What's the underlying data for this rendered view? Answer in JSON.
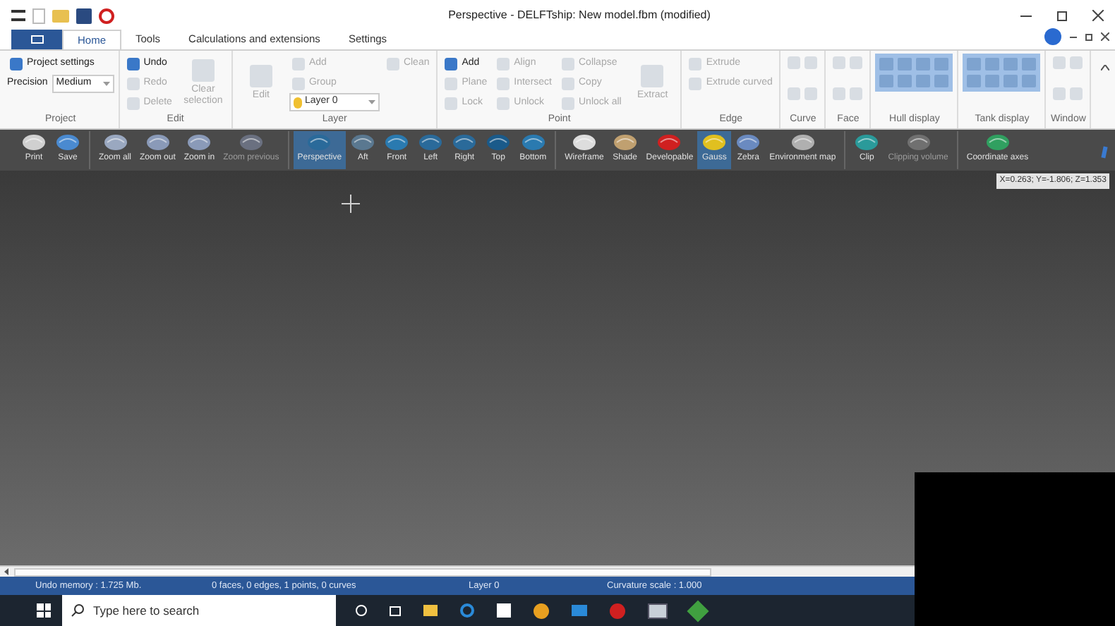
{
  "window": {
    "title": "Perspective - DELFTship: New model.fbm (modified)"
  },
  "tabs": [
    {
      "label": "Home",
      "selected": true
    },
    {
      "label": "Tools",
      "selected": false
    },
    {
      "label": "Calculations and extensions",
      "selected": false
    },
    {
      "label": "Settings",
      "selected": false
    }
  ],
  "ribbon": [
    {
      "label": "Project",
      "kind": "items",
      "items": [
        {
          "kind": "small",
          "label": "Project settings",
          "disabled": false
        },
        {
          "kind": "labelled-select",
          "label": "Precision",
          "value": "Medium"
        }
      ]
    },
    {
      "label": "Edit",
      "kind": "items",
      "items": [
        {
          "kind": "small",
          "label": "Undo",
          "disabled": false
        },
        {
          "kind": "small",
          "label": "Redo",
          "disabled": true
        },
        {
          "kind": "small",
          "label": "Delete",
          "disabled": true
        },
        {
          "kind": "large",
          "label": "Clear selection",
          "disabled": true
        }
      ]
    },
    {
      "label": "Layer",
      "kind": "items",
      "items": [
        {
          "kind": "large",
          "label": "Edit",
          "disabled": true
        },
        {
          "kind": "small",
          "label": "Add",
          "disabled": true
        },
        {
          "kind": "small",
          "label": "Group",
          "disabled": true
        },
        {
          "kind": "select",
          "value": "Layer 0"
        },
        {
          "kind": "small",
          "label": "Clean",
          "disabled": true
        }
      ]
    },
    {
      "label": "Point",
      "kind": "items",
      "items": [
        {
          "kind": "small",
          "label": "Add",
          "disabled": false
        },
        {
          "kind": "small",
          "label": "Plane",
          "disabled": true
        },
        {
          "kind": "small",
          "label": "Lock",
          "disabled": true
        },
        {
          "kind": "small",
          "label": "Align",
          "disabled": true
        },
        {
          "kind": "small",
          "label": "Intersect",
          "disabled": true
        },
        {
          "kind": "small",
          "label": "Unlock",
          "disabled": true
        },
        {
          "kind": "small",
          "label": "Collapse",
          "disabled": true
        },
        {
          "kind": "small",
          "label": "Copy",
          "disabled": true
        },
        {
          "kind": "small",
          "label": "Unlock all",
          "disabled": true
        },
        {
          "kind": "large",
          "label": "Extract",
          "disabled": true
        }
      ]
    },
    {
      "label": "Edge",
      "kind": "items",
      "items": [
        {
          "kind": "small",
          "label": "Extrude",
          "disabled": true
        },
        {
          "kind": "small",
          "label": "Extrude curved",
          "disabled": true
        }
      ]
    },
    {
      "label": "Curve",
      "kind": "icons"
    },
    {
      "label": "Face",
      "kind": "icons"
    },
    {
      "label": "Hull display",
      "kind": "display"
    },
    {
      "label": "Tank display",
      "kind": "display"
    },
    {
      "label": "Window",
      "kind": "icons"
    }
  ],
  "toolbar": [
    [
      {
        "label": "Print",
        "selected": false,
        "disabled": false
      },
      {
        "label": "Save",
        "selected": false,
        "disabled": false
      }
    ],
    [
      {
        "label": "Zoom all",
        "selected": false,
        "disabled": false
      },
      {
        "label": "Zoom out",
        "selected": false,
        "disabled": false
      },
      {
        "label": "Zoom in",
        "selected": false,
        "disabled": false
      },
      {
        "label": "Zoom previous",
        "selected": false,
        "disabled": true
      }
    ],
    [
      {
        "label": "Perspective",
        "selected": true,
        "disabled": false
      },
      {
        "label": "Aft",
        "selected": false,
        "disabled": false
      },
      {
        "label": "Front",
        "selected": false,
        "disabled": false
      },
      {
        "label": "Left",
        "selected": false,
        "disabled": false
      },
      {
        "label": "Right",
        "selected": false,
        "disabled": false
      },
      {
        "label": "Top",
        "selected": false,
        "disabled": false
      },
      {
        "label": "Bottom",
        "selected": false,
        "disabled": false
      }
    ],
    [
      {
        "label": "Wireframe",
        "selected": false,
        "disabled": false
      },
      {
        "label": "Shade",
        "selected": false,
        "disabled": false
      },
      {
        "label": "Developable",
        "selected": false,
        "disabled": false
      },
      {
        "label": "Gauss",
        "selected": true,
        "disabled": false
      },
      {
        "label": "Zebra",
        "selected": false,
        "disabled": false
      },
      {
        "label": "Environment map",
        "selected": false,
        "disabled": false
      }
    ],
    [
      {
        "label": "Clip",
        "selected": false,
        "disabled": false
      },
      {
        "label": "Clipping volume",
        "selected": false,
        "disabled": true
      }
    ],
    [
      {
        "label": "Coordinate axes",
        "selected": false,
        "disabled": false
      }
    ]
  ],
  "viewport": {
    "coordinates": "X=0.263; Y=-1.806; Z=1.353"
  },
  "status_bar": [
    "Undo memory : 1.725 Mb.",
    "0 faces, 0 edges, 1 points, 0 curves",
    "Layer 0",
    "Curvature scale : 1.000"
  ],
  "taskbar": {
    "search": {
      "placeholder": "Type here to search"
    }
  }
}
